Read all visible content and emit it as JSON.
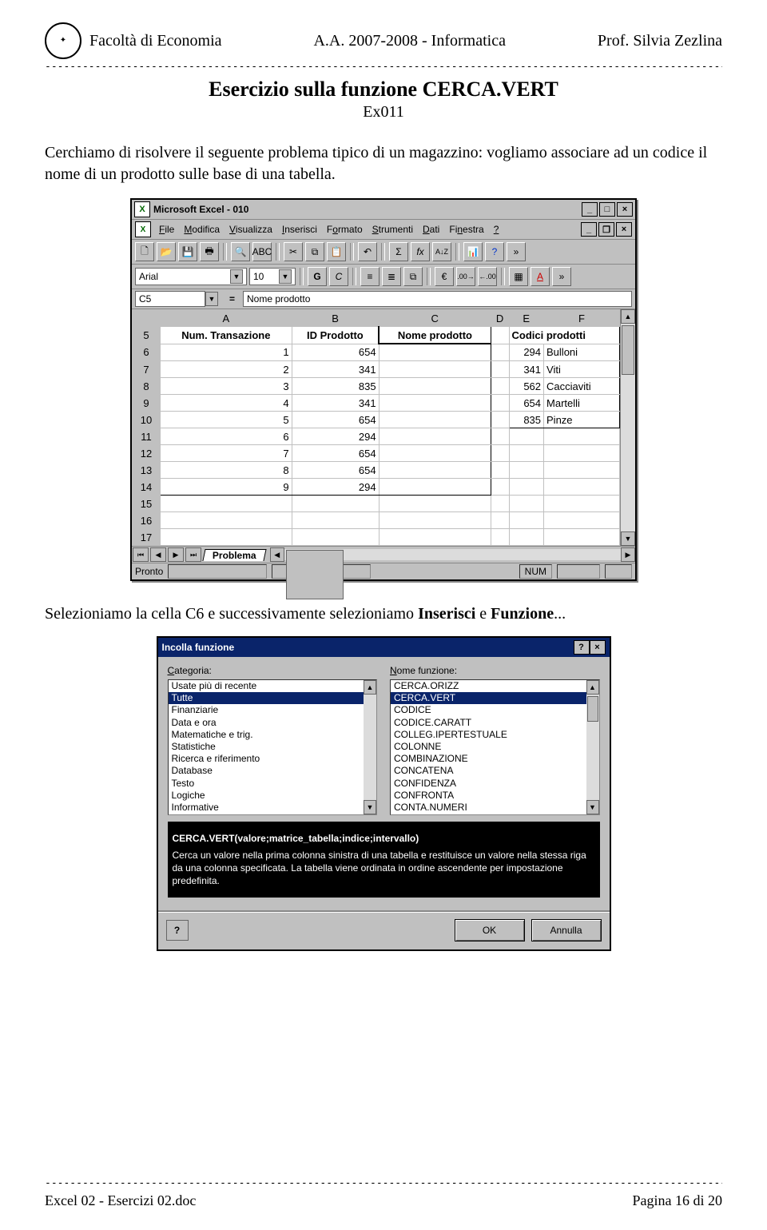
{
  "header": {
    "left": "Facoltà di Economia",
    "center": "A.A. 2007-2008 - Informatica",
    "right": "Prof. Silvia Zezlina"
  },
  "title": "Esercizio sulla funzione CERCA.VERT",
  "subtitle": "Ex011",
  "para1": "Cerchiamo di risolvere il seguente problema tipico di un magazzino: vogliamo associare ad un codice il nome di un prodotto sulle base di una tabella.",
  "para2_pre": "Selezioniamo la cella C6 e successivamente selezioniamo ",
  "para2_bold1": "Inserisci",
  "para2_mid": " e ",
  "para2_bold2": "Funzione",
  "para2_suffix": "...",
  "footer": {
    "left": "Excel 02 - Esercizi 02.doc",
    "right": "Pagina 16 di 20"
  },
  "excel": {
    "title": "Microsoft Excel - 010",
    "menus": [
      "File",
      "Modifica",
      "Visualizza",
      "Inserisci",
      "Formato",
      "Strumenti",
      "Dati",
      "Finestra",
      "?"
    ],
    "font": "Arial",
    "size": "10",
    "cellref": "C5",
    "formula": "Nome prodotto",
    "cols": [
      "A",
      "B",
      "C",
      "D",
      "E",
      "F"
    ],
    "row5": {
      "A": "Num. Transazione",
      "B": "ID Prodotto",
      "C": "Nome prodotto",
      "E": "Codici prodotti"
    },
    "rows": [
      {
        "n": "6",
        "A": "1",
        "B": "654",
        "E": "294",
        "F": "Bulloni"
      },
      {
        "n": "7",
        "A": "2",
        "B": "341",
        "E": "341",
        "F": "Viti"
      },
      {
        "n": "8",
        "A": "3",
        "B": "835",
        "E": "562",
        "F": "Cacciaviti"
      },
      {
        "n": "9",
        "A": "4",
        "B": "341",
        "E": "654",
        "F": "Martelli"
      },
      {
        "n": "10",
        "A": "5",
        "B": "654",
        "E": "835",
        "F": "Pinze"
      },
      {
        "n": "11",
        "A": "6",
        "B": "294"
      },
      {
        "n": "12",
        "A": "7",
        "B": "654"
      },
      {
        "n": "13",
        "A": "8",
        "B": "654"
      },
      {
        "n": "14",
        "A": "9",
        "B": "294"
      },
      {
        "n": "15"
      },
      {
        "n": "16"
      },
      {
        "n": "17"
      }
    ],
    "tab": "Problema",
    "status": "Pronto",
    "numlock": "NUM"
  },
  "dialog": {
    "title": "Incolla funzione",
    "category_label": "Categoria:",
    "name_label": "Nome funzione:",
    "categories": [
      "Usate più di recente",
      "Tutte",
      "Finanziarie",
      "Data e ora",
      "Matematiche e trig.",
      "Statistiche",
      "Ricerca e riferimento",
      "Database",
      "Testo",
      "Logiche",
      "Informative"
    ],
    "categories_selected": "Tutte",
    "functions": [
      "CERCA.ORIZZ",
      "CERCA.VERT",
      "CODICE",
      "CODICE.CARATT",
      "COLLEG.IPERTESTUALE",
      "COLONNE",
      "COMBINAZIONE",
      "CONCATENA",
      "CONFIDENZA",
      "CONFRONTA",
      "CONTA.NUMERI"
    ],
    "functions_selected": "CERCA.VERT",
    "signature": "CERCA.VERT(valore;matrice_tabella;indice;intervallo)",
    "description": "Cerca un valore nella prima colonna sinistra di una tabella e restituisce un valore nella stessa riga da una colonna specificata. La tabella viene ordinata in ordine ascendente per impostazione predefinita.",
    "help": "?",
    "ok": "OK",
    "cancel": "Annulla"
  },
  "icons": {
    "euro": "€",
    "sigma": "Σ",
    "fx": "fx",
    "sort": "A↓Z",
    "abc": "ABC",
    "bold": "G",
    "italic": "C"
  }
}
